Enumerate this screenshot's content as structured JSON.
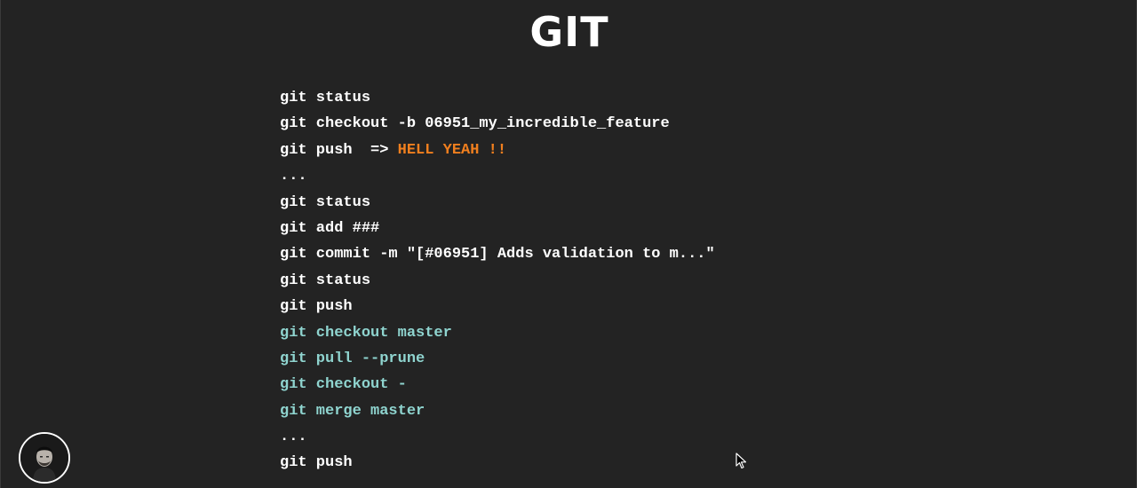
{
  "slide": {
    "title": "GIT",
    "lines": [
      {
        "text": "git status",
        "style": "white"
      },
      {
        "text": "git checkout -b 06951_my_incredible_feature",
        "style": "white"
      },
      {
        "text": "git push  => ",
        "highlight": "HELL YEAH !!",
        "style": "white"
      },
      {
        "text": "...",
        "style": "white"
      },
      {
        "text": "git status",
        "style": "white"
      },
      {
        "text": "git add ###",
        "style": "white"
      },
      {
        "text": "git commit -m \"[#06951] Adds validation to m...\"",
        "style": "white"
      },
      {
        "text": "git status",
        "style": "white"
      },
      {
        "text": "git push",
        "style": "white"
      },
      {
        "text": "git checkout master",
        "style": "teal"
      },
      {
        "text": "git pull --prune",
        "style": "teal"
      },
      {
        "text": "git checkout -",
        "style": "teal"
      },
      {
        "text": "git merge master",
        "style": "teal"
      },
      {
        "text": "...",
        "style": "white"
      },
      {
        "text": "git push",
        "style": "white"
      }
    ]
  },
  "colors": {
    "background": "#232323",
    "text": "#ffffff",
    "teal": "#8fd4cf",
    "highlight": "#f07f1e"
  },
  "icons": {
    "avatar": "presenter-avatar",
    "cursor": "mouse-pointer-icon"
  }
}
